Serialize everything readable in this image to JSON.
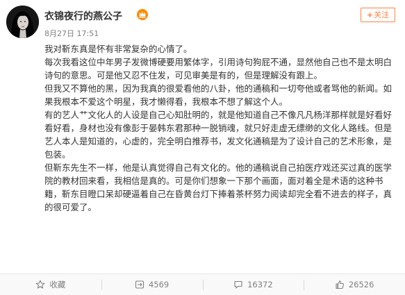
{
  "post": {
    "username": "衣锦夜行的燕公子",
    "timestamp": "8月27日 17:51",
    "follow_label": "关注",
    "follow_plus": "+",
    "paragraphs": [
      "我对靳东真是怀有非常复杂的心情了。",
      "每次我看这位中年男子发微博硬要用繁体字，引用诗句狗屁不通，显然他自己也不是太明白诗句的意思。可是他又忍不住发，可见审美是有的，但是理解没有跟上。",
      "但我又不算他的黑，因为我真的很爱看他的八卦，他的通稿和一切夸他或者骂他的新闻。如果我根本不爱这个明星，我才懒得看，我根本不想了解这个人。",
      "有的艺人艹文化人的人设是自己心知肚明的，就是他知道自己不像凡凡杨洋那样就是好看好看好看，身材也没有像彭于晏韩东君那种一脱销魂，就只好走虚无缥缈的文化人路线。但是艺人本人是知道的，心虚的，完全明白推荐书，发文化通稿是为了设计自己的艺术形象，是包装。",
      "但靳东先生不一样，他是认真觉得自己有文化的。他的通稿说自己拍医疗戏还买过真的医学院的教材回来看，我相信是真的。可是你们想象一下那个画面，面对着全是术语的这种书籍，靳东目瞪口呆却硬逼着自己在昏黄台灯下捧着茶杯努力阅读却完全看不进去的样子，真的很可爱了。"
    ]
  },
  "actions": {
    "favorite": {
      "label": "收藏",
      "icon": "star-icon"
    },
    "repost": {
      "count": "4569",
      "icon": "repost-icon"
    },
    "comment": {
      "count": "16372",
      "icon": "comment-icon"
    },
    "like": {
      "count": "26526",
      "icon": "thumbs-up-icon"
    }
  },
  "colors": {
    "accent": "#ff8140",
    "text": "#333333",
    "muted": "#808080",
    "vip": "#ff8a00"
  }
}
